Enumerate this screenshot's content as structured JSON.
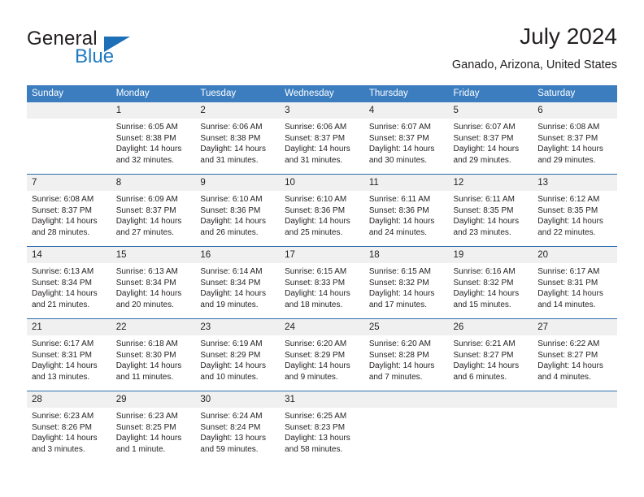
{
  "brand": {
    "name_part1": "General",
    "name_part2": "Blue",
    "triangle_icon": "triangle-icon"
  },
  "header": {
    "title": "July 2024",
    "location": "Ganado, Arizona, United States"
  },
  "colors": {
    "header_blue": "#3b7dbf",
    "row_border_blue": "#2e6fae",
    "daynum_background": "#f0f0f0",
    "brand_blue": "#1f7ac0",
    "text": "#231f20"
  },
  "weekdays": [
    "Sunday",
    "Monday",
    "Tuesday",
    "Wednesday",
    "Thursday",
    "Friday",
    "Saturday"
  ],
  "weeks": [
    [
      {
        "day": "",
        "lines": []
      },
      {
        "day": "1",
        "lines": [
          "Sunrise: 6:05 AM",
          "Sunset: 8:38 PM",
          "Daylight: 14 hours",
          "and 32 minutes."
        ]
      },
      {
        "day": "2",
        "lines": [
          "Sunrise: 6:06 AM",
          "Sunset: 8:38 PM",
          "Daylight: 14 hours",
          "and 31 minutes."
        ]
      },
      {
        "day": "3",
        "lines": [
          "Sunrise: 6:06 AM",
          "Sunset: 8:37 PM",
          "Daylight: 14 hours",
          "and 31 minutes."
        ]
      },
      {
        "day": "4",
        "lines": [
          "Sunrise: 6:07 AM",
          "Sunset: 8:37 PM",
          "Daylight: 14 hours",
          "and 30 minutes."
        ]
      },
      {
        "day": "5",
        "lines": [
          "Sunrise: 6:07 AM",
          "Sunset: 8:37 PM",
          "Daylight: 14 hours",
          "and 29 minutes."
        ]
      },
      {
        "day": "6",
        "lines": [
          "Sunrise: 6:08 AM",
          "Sunset: 8:37 PM",
          "Daylight: 14 hours",
          "and 29 minutes."
        ]
      }
    ],
    [
      {
        "day": "7",
        "lines": [
          "Sunrise: 6:08 AM",
          "Sunset: 8:37 PM",
          "Daylight: 14 hours",
          "and 28 minutes."
        ]
      },
      {
        "day": "8",
        "lines": [
          "Sunrise: 6:09 AM",
          "Sunset: 8:37 PM",
          "Daylight: 14 hours",
          "and 27 minutes."
        ]
      },
      {
        "day": "9",
        "lines": [
          "Sunrise: 6:10 AM",
          "Sunset: 8:36 PM",
          "Daylight: 14 hours",
          "and 26 minutes."
        ]
      },
      {
        "day": "10",
        "lines": [
          "Sunrise: 6:10 AM",
          "Sunset: 8:36 PM",
          "Daylight: 14 hours",
          "and 25 minutes."
        ]
      },
      {
        "day": "11",
        "lines": [
          "Sunrise: 6:11 AM",
          "Sunset: 8:36 PM",
          "Daylight: 14 hours",
          "and 24 minutes."
        ]
      },
      {
        "day": "12",
        "lines": [
          "Sunrise: 6:11 AM",
          "Sunset: 8:35 PM",
          "Daylight: 14 hours",
          "and 23 minutes."
        ]
      },
      {
        "day": "13",
        "lines": [
          "Sunrise: 6:12 AM",
          "Sunset: 8:35 PM",
          "Daylight: 14 hours",
          "and 22 minutes."
        ]
      }
    ],
    [
      {
        "day": "14",
        "lines": [
          "Sunrise: 6:13 AM",
          "Sunset: 8:34 PM",
          "Daylight: 14 hours",
          "and 21 minutes."
        ]
      },
      {
        "day": "15",
        "lines": [
          "Sunrise: 6:13 AM",
          "Sunset: 8:34 PM",
          "Daylight: 14 hours",
          "and 20 minutes."
        ]
      },
      {
        "day": "16",
        "lines": [
          "Sunrise: 6:14 AM",
          "Sunset: 8:34 PM",
          "Daylight: 14 hours",
          "and 19 minutes."
        ]
      },
      {
        "day": "17",
        "lines": [
          "Sunrise: 6:15 AM",
          "Sunset: 8:33 PM",
          "Daylight: 14 hours",
          "and 18 minutes."
        ]
      },
      {
        "day": "18",
        "lines": [
          "Sunrise: 6:15 AM",
          "Sunset: 8:32 PM",
          "Daylight: 14 hours",
          "and 17 minutes."
        ]
      },
      {
        "day": "19",
        "lines": [
          "Sunrise: 6:16 AM",
          "Sunset: 8:32 PM",
          "Daylight: 14 hours",
          "and 15 minutes."
        ]
      },
      {
        "day": "20",
        "lines": [
          "Sunrise: 6:17 AM",
          "Sunset: 8:31 PM",
          "Daylight: 14 hours",
          "and 14 minutes."
        ]
      }
    ],
    [
      {
        "day": "21",
        "lines": [
          "Sunrise: 6:17 AM",
          "Sunset: 8:31 PM",
          "Daylight: 14 hours",
          "and 13 minutes."
        ]
      },
      {
        "day": "22",
        "lines": [
          "Sunrise: 6:18 AM",
          "Sunset: 8:30 PM",
          "Daylight: 14 hours",
          "and 11 minutes."
        ]
      },
      {
        "day": "23",
        "lines": [
          "Sunrise: 6:19 AM",
          "Sunset: 8:29 PM",
          "Daylight: 14 hours",
          "and 10 minutes."
        ]
      },
      {
        "day": "24",
        "lines": [
          "Sunrise: 6:20 AM",
          "Sunset: 8:29 PM",
          "Daylight: 14 hours",
          "and 9 minutes."
        ]
      },
      {
        "day": "25",
        "lines": [
          "Sunrise: 6:20 AM",
          "Sunset: 8:28 PM",
          "Daylight: 14 hours",
          "and 7 minutes."
        ]
      },
      {
        "day": "26",
        "lines": [
          "Sunrise: 6:21 AM",
          "Sunset: 8:27 PM",
          "Daylight: 14 hours",
          "and 6 minutes."
        ]
      },
      {
        "day": "27",
        "lines": [
          "Sunrise: 6:22 AM",
          "Sunset: 8:27 PM",
          "Daylight: 14 hours",
          "and 4 minutes."
        ]
      }
    ],
    [
      {
        "day": "28",
        "lines": [
          "Sunrise: 6:23 AM",
          "Sunset: 8:26 PM",
          "Daylight: 14 hours",
          "and 3 minutes."
        ]
      },
      {
        "day": "29",
        "lines": [
          "Sunrise: 6:23 AM",
          "Sunset: 8:25 PM",
          "Daylight: 14 hours",
          "and 1 minute."
        ]
      },
      {
        "day": "30",
        "lines": [
          "Sunrise: 6:24 AM",
          "Sunset: 8:24 PM",
          "Daylight: 13 hours",
          "and 59 minutes."
        ]
      },
      {
        "day": "31",
        "lines": [
          "Sunrise: 6:25 AM",
          "Sunset: 8:23 PM",
          "Daylight: 13 hours",
          "and 58 minutes."
        ]
      },
      {
        "day": "",
        "lines": []
      },
      {
        "day": "",
        "lines": []
      },
      {
        "day": "",
        "lines": []
      }
    ]
  ]
}
